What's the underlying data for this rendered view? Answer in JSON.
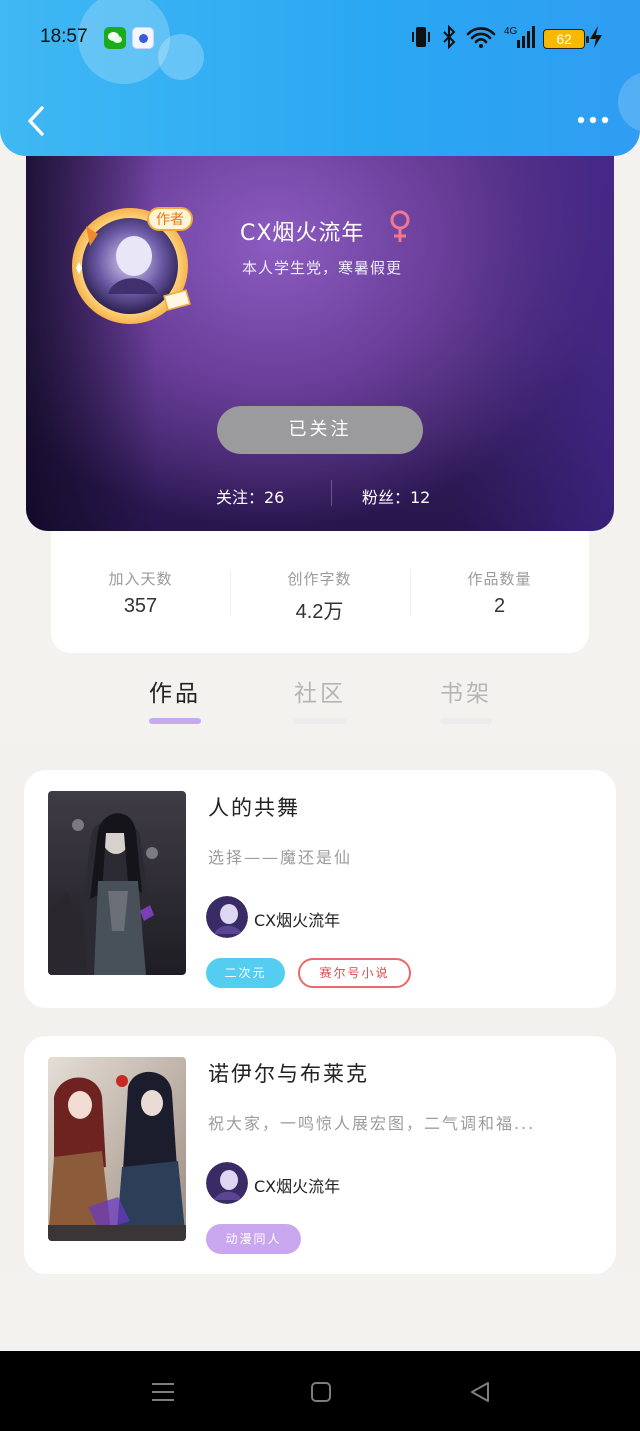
{
  "status_bar": {
    "time": "18:57",
    "battery": "62",
    "network": "4G",
    "icons": [
      "wechat-icon",
      "baidu-icon",
      "vibrate-icon",
      "bluetooth-icon",
      "wifi-icon",
      "signal-icon",
      "battery-icon",
      "charging-icon"
    ]
  },
  "header": {
    "back_icon": "chevron-left-icon",
    "more_icon": "more-dots-icon"
  },
  "profile": {
    "avatar_badge": "作者",
    "nickname": "CX烟火流年",
    "gender": "♀",
    "bio": "本人学生党，寒暑假更",
    "follow_button": "已关注",
    "following": "关注：26",
    "followers": "粉丝：12"
  },
  "stats": [
    {
      "label": "加入天数",
      "value": "357"
    },
    {
      "label": "创作字数",
      "value": "4.2万"
    },
    {
      "label": "作品数量",
      "value": "2"
    }
  ],
  "tabs": [
    {
      "label": "作品",
      "active": true
    },
    {
      "label": "社区",
      "active": false
    },
    {
      "label": "书架",
      "active": false
    }
  ],
  "books": [
    {
      "title": "人的共舞",
      "description": "选择——魔还是仙",
      "author": "CX烟火流年",
      "tags": [
        "二次元",
        "赛尔号小说"
      ]
    },
    {
      "title": "诺伊尔与布莱克",
      "description": "祝大家，一鸣惊人展宏图，二气调和福...",
      "author": "CX烟火流年",
      "tags": [
        "动漫同人"
      ]
    }
  ],
  "colors": {
    "header": "#2aa7f3",
    "follow_button": "#9b9a9d",
    "tab_indicator": "#c5aaf0",
    "tag_blue": "#55cdf0",
    "tag_red": "#e96a6a",
    "tag_purple": "#c8a7ef"
  },
  "nav_bar": {
    "icons": [
      "menu-icon",
      "home-square-icon",
      "back-triangle-icon"
    ]
  }
}
